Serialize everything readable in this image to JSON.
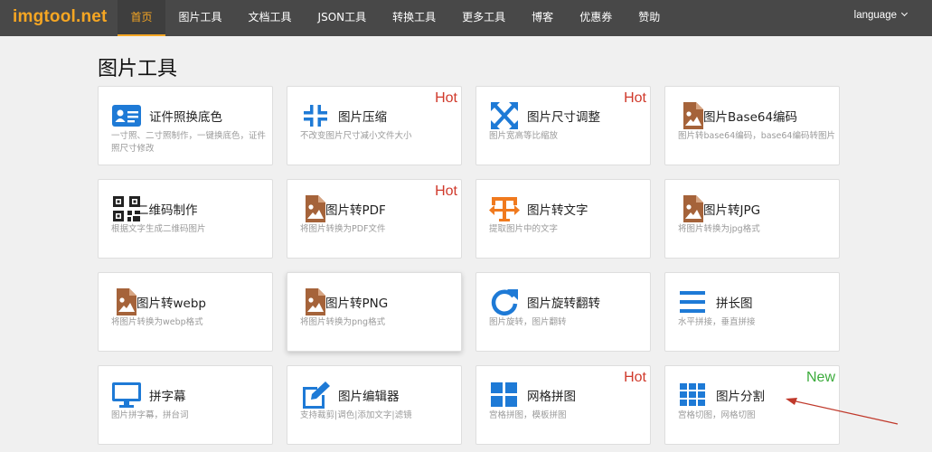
{
  "brand": "imgtool.net",
  "nav": {
    "items": [
      "首页",
      "图片工具",
      "文档工具",
      "JSON工具",
      "转换工具",
      "更多工具",
      "博客",
      "优惠券",
      "赞助"
    ],
    "language": "language"
  },
  "page_title": "图片工具",
  "colors": {
    "navbar": "#484848",
    "brand": "#f5a623",
    "hot": "#d0392b",
    "new": "#3bab3b",
    "icon_blue": "#1e7ad6",
    "icon_brown": "#a5633a",
    "icon_orange": "#f07a1e"
  },
  "cards": [
    {
      "title": "证件照换底色",
      "desc": "一寸照、二寸照制作，一键换底色，证件照尺寸修改",
      "icon": "id-card-icon",
      "badge": ""
    },
    {
      "title": "图片压缩",
      "desc": "不改变图片尺寸减小文件大小",
      "icon": "compress-icon",
      "badge": "Hot"
    },
    {
      "title": "图片尺寸调整",
      "desc": "图片宽高等比缩放",
      "icon": "expand-arrows-icon",
      "badge": "Hot"
    },
    {
      "title": "图片Base64编码",
      "desc": "图片转base64编码，base64编码转图片",
      "icon": "image-file-icon",
      "badge": ""
    },
    {
      "title": "二维码制作",
      "desc": "根据文字生成二维码图片",
      "icon": "qrcode-icon",
      "badge": ""
    },
    {
      "title": "图片转PDF",
      "desc": "将图片转换为PDF文件",
      "icon": "image-file-icon",
      "badge": "Hot"
    },
    {
      "title": "图片转文字",
      "desc": "提取图片中的文字",
      "icon": "text-extract-icon",
      "badge": ""
    },
    {
      "title": "图片转JPG",
      "desc": "将图片转换为jpg格式",
      "icon": "image-file-icon",
      "badge": ""
    },
    {
      "title": "图片转webp",
      "desc": "将图片转换为webp格式",
      "icon": "image-file-icon",
      "badge": ""
    },
    {
      "title": "图片转PNG",
      "desc": "将图片转换为png格式",
      "icon": "image-file-icon",
      "badge": ""
    },
    {
      "title": "图片旋转翻转",
      "desc": "图片旋转，图片翻转",
      "icon": "rotate-icon",
      "badge": ""
    },
    {
      "title": "拼长图",
      "desc": "水平拼接，垂直拼接",
      "icon": "list-bars-icon",
      "badge": ""
    },
    {
      "title": "拼字幕",
      "desc": "图片拼字幕，拼台词",
      "icon": "monitor-icon",
      "badge": ""
    },
    {
      "title": "图片编辑器",
      "desc": "支持裁剪|调色|添加文字|滤镜",
      "icon": "edit-icon",
      "badge": ""
    },
    {
      "title": "网格拼图",
      "desc": "宫格拼图，模板拼图",
      "icon": "grid-2x2-icon",
      "badge": "Hot"
    },
    {
      "title": "图片分割",
      "desc": "宫格切图，网格切图",
      "icon": "grid-3x3-icon",
      "badge": "New"
    }
  ]
}
